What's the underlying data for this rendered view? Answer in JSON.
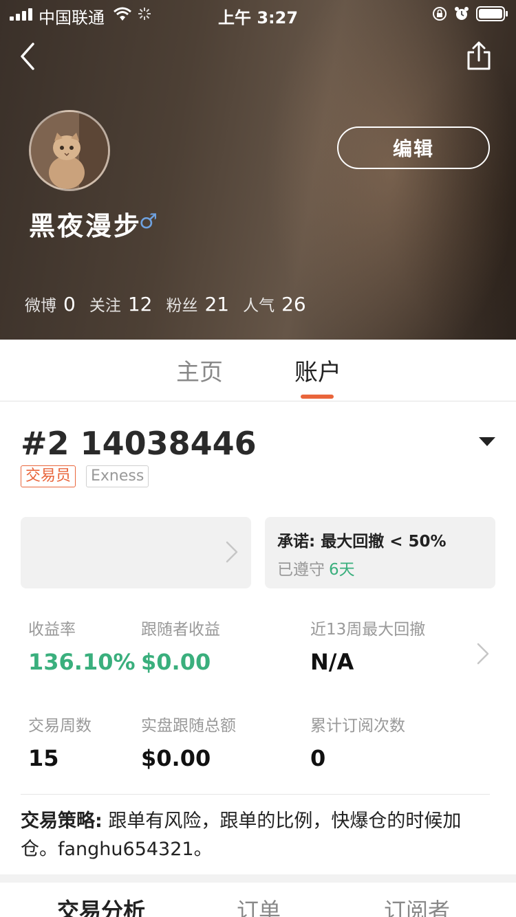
{
  "status_bar": {
    "carrier": "中国联通",
    "time": "上午 3:27"
  },
  "profile": {
    "username": "黑夜漫步",
    "gender_symbol": "♂",
    "edit_label": "编辑",
    "stats": [
      {
        "label": "微博",
        "value": "0"
      },
      {
        "label": "关注",
        "value": "12"
      },
      {
        "label": "粉丝",
        "value": "21"
      },
      {
        "label": "人气",
        "value": "26"
      }
    ]
  },
  "tabs": {
    "home": "主页",
    "account": "账户",
    "active": "account"
  },
  "account": {
    "title": "#2 14038446",
    "badges": [
      "交易员",
      "Exness"
    ]
  },
  "promise_card": {
    "promise": "承诺: 最大回撤 < 50%",
    "kept_label": "已遵守",
    "kept_days": "6天"
  },
  "metrics": [
    {
      "label": "收益率",
      "value": "136.10%"
    },
    {
      "label": "跟随者收益",
      "value": "$0.00"
    },
    {
      "label": "近13周最大回撤",
      "value": "N/A"
    },
    {
      "label": "交易周数",
      "value": "15"
    },
    {
      "label": "实盘跟随总额",
      "value": "$0.00"
    },
    {
      "label": "累计订阅次数",
      "value": "0"
    }
  ],
  "strategy": {
    "label": "交易策略:",
    "text": " 跟单有风险，跟单的比例，快爆仓的时候加仓。fanghu654321。"
  },
  "bottom_tabs": [
    "交易分析",
    "订单",
    "订阅者"
  ],
  "colors": {
    "accent_orange": "#e9653b",
    "positive_green": "#3aaf7d",
    "gender_blue": "#6fa2e0"
  },
  "icons": {
    "back": "back-arrow-icon",
    "share": "share-icon",
    "dropdown": "caret-down-icon",
    "chevron": "chevron-right-icon"
  }
}
